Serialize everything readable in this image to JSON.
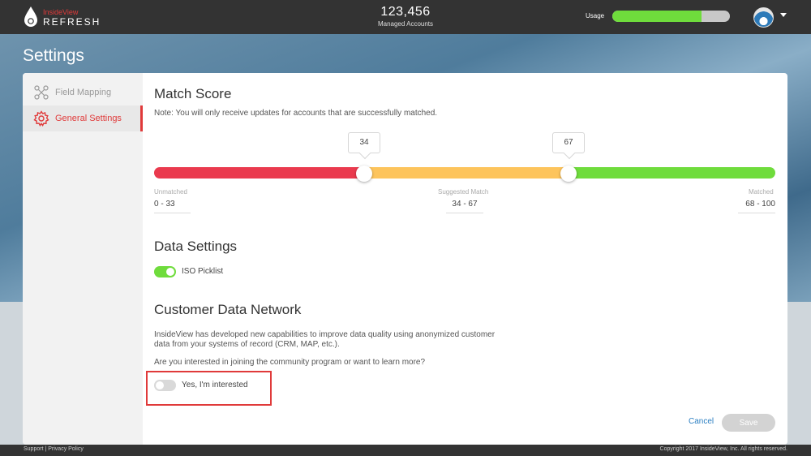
{
  "header": {
    "brand": "InsideView",
    "product": "REFRESH",
    "accounts_count": "123,456",
    "accounts_label": "Managed Accounts",
    "usage_label": "Usage",
    "usage_fraction": 0.76
  },
  "page_title": "Settings",
  "sidebar": {
    "items": [
      {
        "label": "Field Mapping",
        "icon": "nodes-icon",
        "active": false
      },
      {
        "label": "General Settings",
        "icon": "gear-icon",
        "active": true
      }
    ]
  },
  "match_score": {
    "title": "Match Score",
    "note": "Note: You will only receive updates for accounts that are successfully matched.",
    "low_threshold": 34,
    "high_threshold": 67,
    "low_bubble": "34",
    "high_bubble": "67",
    "ranges": [
      {
        "label": "Unmatched",
        "value": "0 - 33",
        "color": "#ea3a4e"
      },
      {
        "label": "Suggested Match",
        "value": "34 - 67",
        "color": "#fdc45c"
      },
      {
        "label": "Matched",
        "value": "68 - 100",
        "color": "#6fdc3c"
      }
    ]
  },
  "data_settings": {
    "title": "Data Settings",
    "iso_picklist_label": "ISO Picklist",
    "iso_picklist_on": true
  },
  "customer_data_network": {
    "title": "Customer Data Network",
    "description": "InsideView has developed new capabilities to improve data quality using anonymized customer data from your systems of record (CRM, MAP, etc.).",
    "question": "Are you interested in joining the community program or want to learn more?",
    "interested_label": "Yes, I'm interested",
    "interested_on": false
  },
  "actions": {
    "cancel_label": "Cancel",
    "save_label": "Save"
  },
  "footer": {
    "support_label": "Support",
    "separator": " | ",
    "privacy_label": "Privacy Policy",
    "copyright": "Copyright 2017 InsideView, Inc. All rights reserved."
  },
  "colors": {
    "accent_red": "#e03a3a",
    "toggle_on": "#6fdc3c",
    "toggle_off": "#d9d9d9",
    "link_blue": "#2b7fc2"
  }
}
